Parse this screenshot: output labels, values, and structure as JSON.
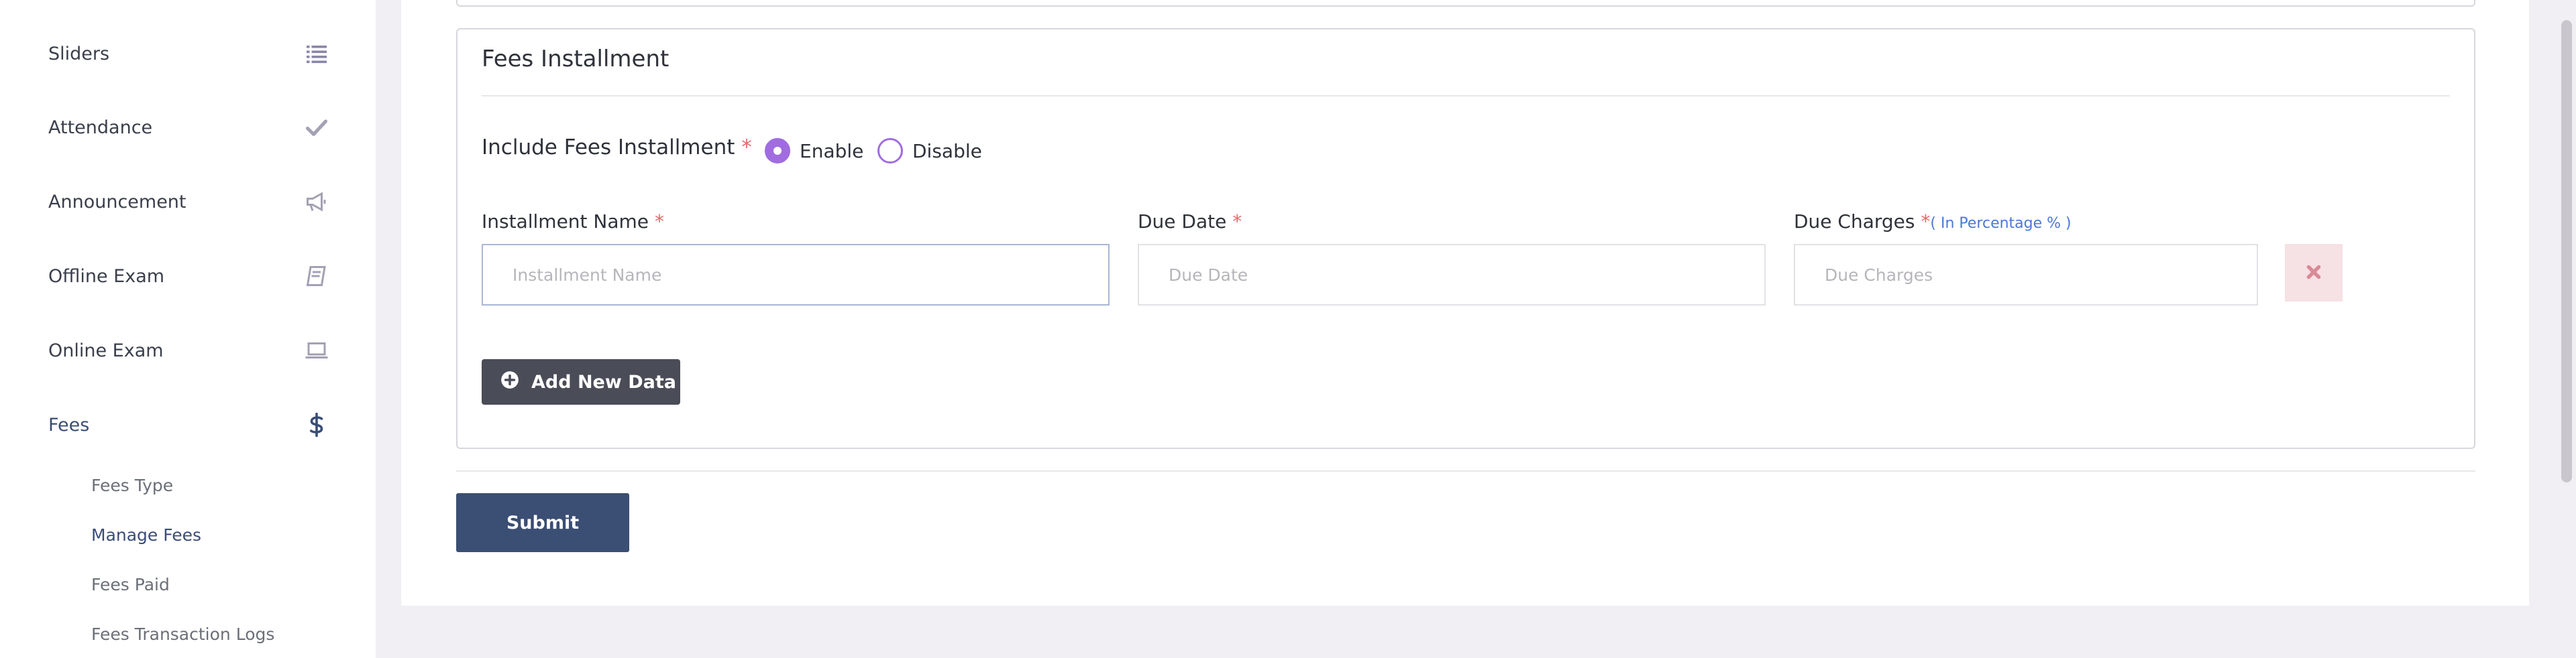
{
  "sidebar": {
    "items": [
      {
        "label": "Sliders",
        "icon": "list-icon"
      },
      {
        "label": "Attendance",
        "icon": "check-icon"
      },
      {
        "label": "Announcement",
        "icon": "megaphone-icon"
      },
      {
        "label": "Offline Exam",
        "icon": "book-icon"
      },
      {
        "label": "Online Exam",
        "icon": "laptop-icon"
      },
      {
        "label": "Fees",
        "icon": "dollar-icon",
        "active": true
      }
    ],
    "fees_submenu": [
      {
        "label": "Fees Type"
      },
      {
        "label": "Manage Fees",
        "active": true
      },
      {
        "label": "Fees Paid"
      },
      {
        "label": "Fees Transaction Logs"
      }
    ]
  },
  "form": {
    "section_title": "Fees Installment",
    "include_label": "Include Fees Installment",
    "required_mark": "*",
    "options": {
      "enable": "Enable",
      "disable": "Disable",
      "selected": "Enable"
    },
    "fields": {
      "installment_name": {
        "label": "Installment Name",
        "placeholder": "Installment Name",
        "value": ""
      },
      "due_date": {
        "label": "Due Date",
        "placeholder": "Due Date",
        "value": ""
      },
      "due_charges": {
        "label": "Due Charges",
        "hint": "( In Percentage % )",
        "placeholder": "Due Charges",
        "value": ""
      }
    },
    "add_button": "Add New Data",
    "submit_button": "Submit"
  },
  "colors": {
    "accent_radio": "#a06ce0",
    "primary_button": "#3b4e73",
    "dark_button": "#4a4d57",
    "danger_bg": "#f6e1e4",
    "danger_icon": "#d98a96",
    "sidebar_active": "#3a4d75",
    "hint": "#4a78d4",
    "required": "#e06a6a"
  }
}
